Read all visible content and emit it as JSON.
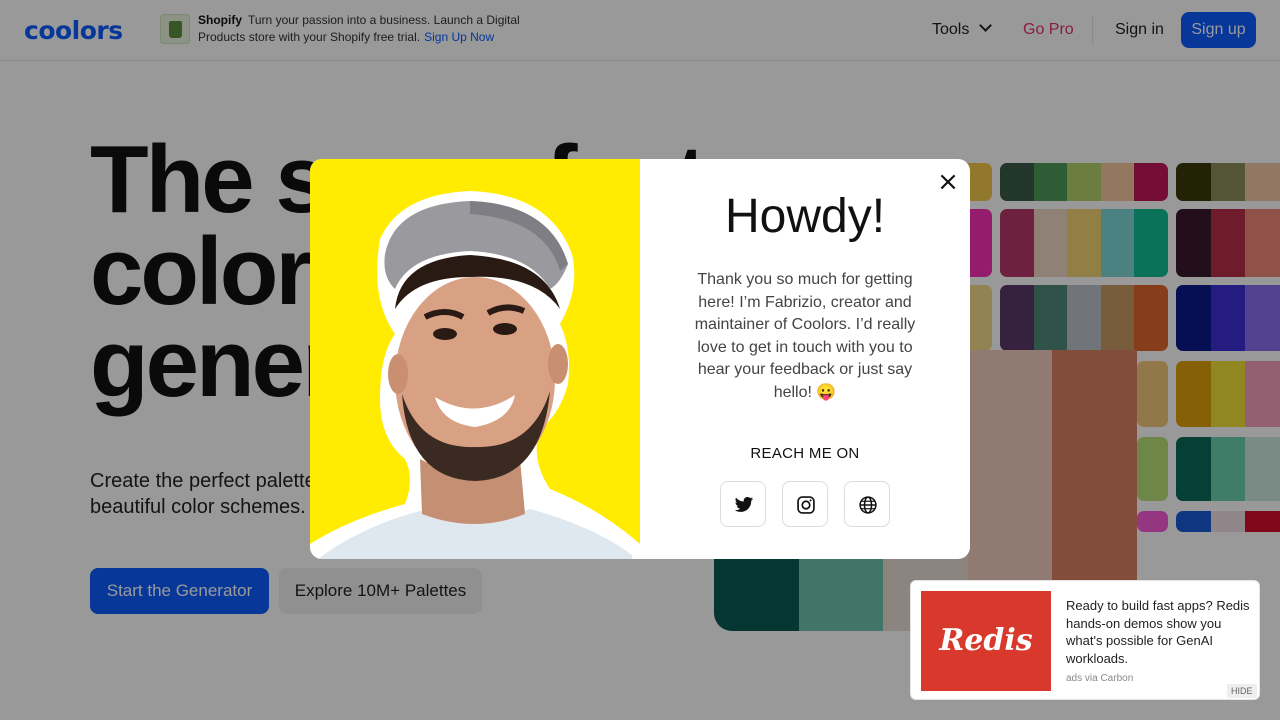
{
  "header": {
    "logo": "coolors",
    "ad": {
      "brand": "Shopify",
      "text_line1": "Turn your passion into a business. Launch a Digital",
      "text_line2": "Products store with your Shopify free trial.",
      "cta": "Sign Up Now"
    },
    "nav": {
      "tools": "Tools",
      "go_pro": "Go Pro",
      "sign_in": "Sign in",
      "sign_up": "Sign up"
    }
  },
  "hero": {
    "title_lines": [
      "The super fast",
      "color palettes",
      "generator!"
    ],
    "subtitle": "Create the perfect palette or get inspired by thousands of beautiful color schemes.",
    "primary_button": "Start the Generator",
    "secondary_button": "Explore 10M+ Palettes"
  },
  "modal": {
    "title": "Howdy!",
    "body": "Thank you so much for getting here! I’m Fabrizio, creator and maintainer of Coolors. I’d really love to get in touch with you to hear your feedback or just say hello! 😛",
    "reach_label": "REACH ME ON",
    "close_icon": "close-icon",
    "social_icons": [
      "twitter-icon",
      "instagram-icon",
      "globe-icon"
    ]
  },
  "bottom_ad": {
    "brand": "Redis",
    "text": "Ready to build fast apps? Redis hands-on demos show you what's possible for GenAI workloads.",
    "via": "ads via Carbon",
    "hide": "HIDE"
  },
  "colors": {
    "brand_blue": "#0b5cff",
    "go_pro_pink": "#e0336b",
    "modal_photo_bg": "#ffec00",
    "redis_red": "#d8392c"
  }
}
